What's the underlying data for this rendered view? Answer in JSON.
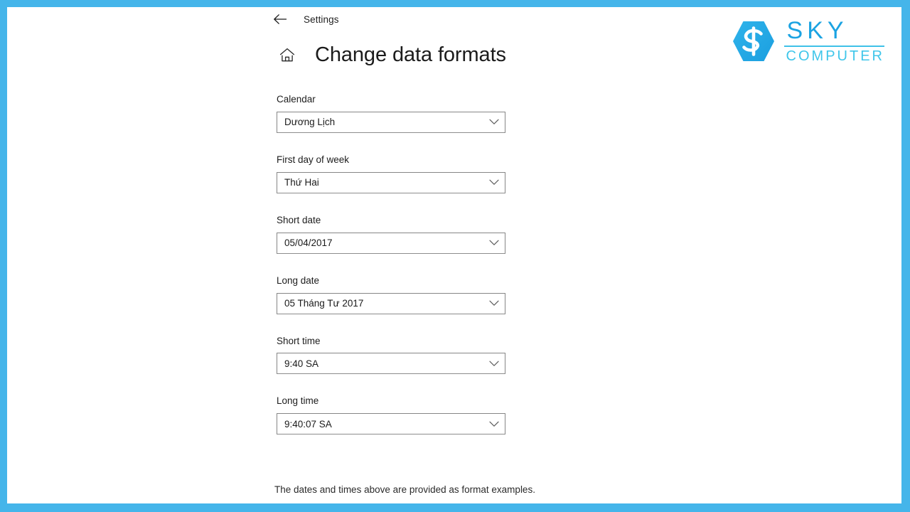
{
  "frame": {
    "border_color": "#45b5ea"
  },
  "titlebar": {
    "back_icon": "back-arrow-icon",
    "app_name": "Settings"
  },
  "header": {
    "home_icon": "home-icon",
    "title": "Change data formats"
  },
  "logo": {
    "mark_icon": "sky-hexagon-s-logo-icon",
    "primary_text": "SKY",
    "secondary_text": "COMPUTER",
    "primary_color": "#1ba3e2",
    "secondary_color": "#3fc6ea"
  },
  "form": {
    "fields": [
      {
        "label": "Calendar",
        "value": "Dương Lịch",
        "name": "calendar"
      },
      {
        "label": "First day of week",
        "value": "Thứ Hai",
        "name": "first-day-of-week"
      },
      {
        "label": "Short date",
        "value": "05/04/2017",
        "name": "short-date"
      },
      {
        "label": "Long date",
        "value": "05 Tháng Tư 2017",
        "name": "long-date"
      },
      {
        "label": "Short time",
        "value": "9:40 SA",
        "name": "short-time"
      },
      {
        "label": "Long time",
        "value": "9:40:07 SA",
        "name": "long-time"
      }
    ]
  },
  "footer": {
    "note": "The dates and times above are provided as format examples."
  }
}
